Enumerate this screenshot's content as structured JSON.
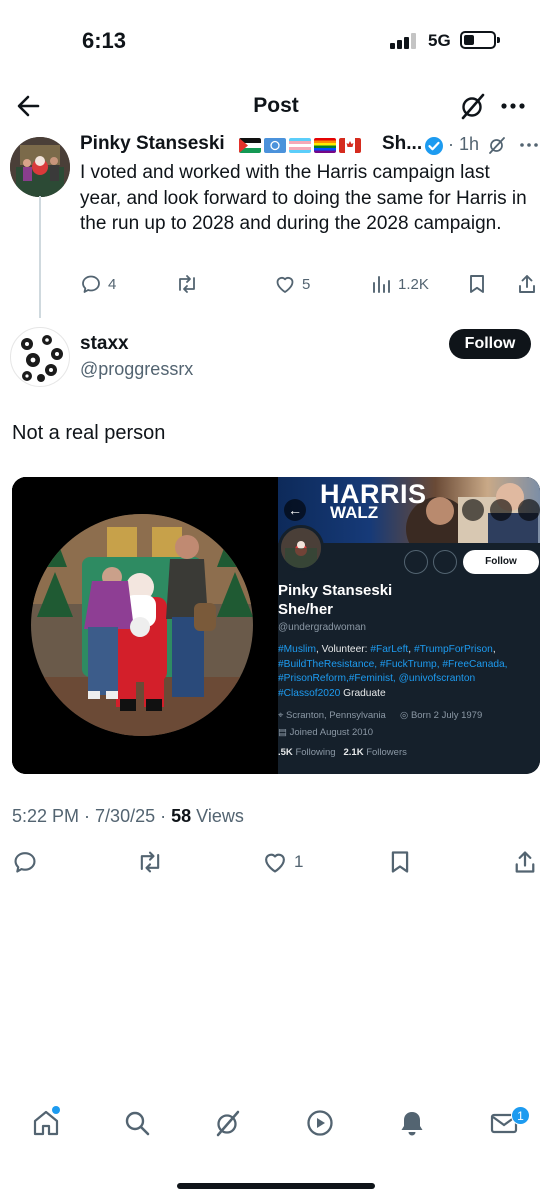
{
  "status_bar": {
    "time": "6:13",
    "network": "5G"
  },
  "header": {
    "title": "Post"
  },
  "parent_tweet": {
    "name": "Pinky Stanseski",
    "name_tail": "Sh...",
    "time": "1h",
    "text": "I voted and worked with the Harris campaign last year, and look forward to doing the same for Harris in the run up to 2028 and during the 2028 campaign.",
    "replies": "4",
    "likes": "5",
    "views": "1.2K",
    "flag_icons": [
      "palestine-flag",
      "un-flag",
      "trans-flag",
      "rainbow-flag",
      "canada-flag"
    ]
  },
  "reply": {
    "name": "staxx",
    "handle": "@proggressrx",
    "follow_label": "Follow",
    "text": "Not a real person"
  },
  "media": {
    "banner_text_1": "HARRIS",
    "banner_text_2": "WALZ",
    "follow_label": "Follow",
    "name": "Pinky Stanseski",
    "pronouns": "She/her",
    "handle": "@undergradwoman",
    "bio_line1_tag": "#Muslim",
    "bio_line1_text": ", Volunteer: ",
    "bio_line1_tag2": "#FarLeft",
    "bio_line1_tag3": "#TrumpForPrison",
    "bio_line2": "#BuildTheResistance, #FuckTrump, #FreeCanada,",
    "bio_line3": "#PrisonReform,#Feminist, @univofscranton",
    "bio_line4_tag": "#Classof2020",
    "bio_line4_text": " Graduate",
    "location": "Scranton, Pennsylvania",
    "born": "Born 2 July 1979",
    "joined": "Joined August 2010",
    "following_count": ".5K",
    "following_label": "Following",
    "followers_count": "2.1K",
    "followers_label": "Followers"
  },
  "post_meta": {
    "time": "5:22 PM",
    "date": "7/30/25",
    "views_count": "58",
    "views_label": "Views"
  },
  "reply_actions": {
    "likes": "1"
  },
  "tab_bar": {
    "items": [
      "home-icon",
      "search-icon",
      "grok-icon",
      "video-icon",
      "notifications-icon",
      "messages-icon"
    ],
    "messages_badge": "1"
  },
  "colors": {
    "accent": "#1d9bf0",
    "text": "#0f1419",
    "secondary": "#536471",
    "dark_bg": "#15202b"
  }
}
